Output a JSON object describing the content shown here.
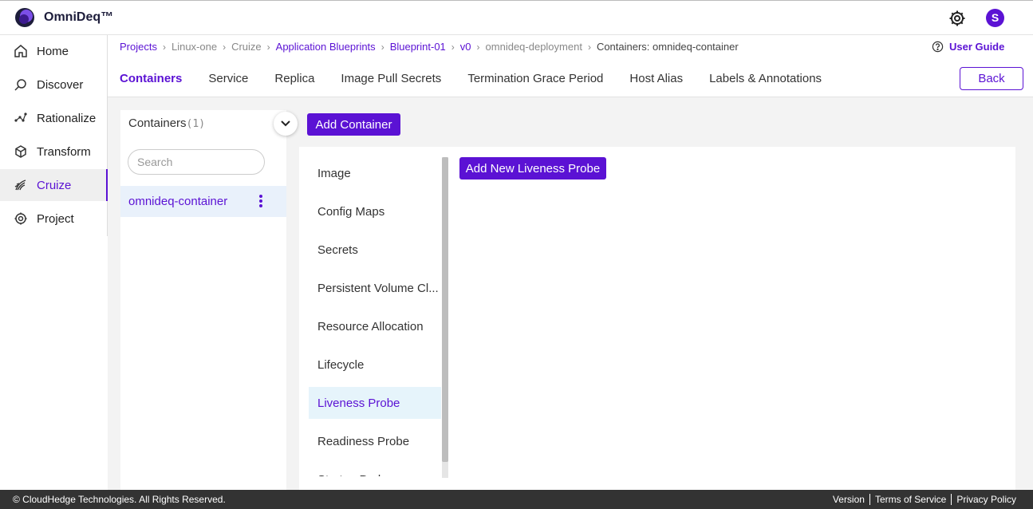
{
  "app": {
    "title": "OmniDeq™",
    "user_initial": "S"
  },
  "sidebar": {
    "items": [
      {
        "label": "Home",
        "icon": "home-icon"
      },
      {
        "label": "Discover",
        "icon": "discover-icon"
      },
      {
        "label": "Rationalize",
        "icon": "rationalize-icon"
      },
      {
        "label": "Transform",
        "icon": "transform-icon"
      },
      {
        "label": "Cruize",
        "icon": "cruize-icon",
        "active": true
      },
      {
        "label": "Project",
        "icon": "project-icon"
      }
    ]
  },
  "breadcrumb": [
    {
      "label": "Projects",
      "link": true
    },
    {
      "label": "Linux-one",
      "link": false
    },
    {
      "label": "Cruize",
      "link": false
    },
    {
      "label": "Application Blueprints",
      "link": true
    },
    {
      "label": "Blueprint-01",
      "link": true
    },
    {
      "label": "v0",
      "link": true
    },
    {
      "label": "omnideq-deployment",
      "link": false
    },
    {
      "label": "Containers: omnideq-container",
      "link": false,
      "current": true
    }
  ],
  "user_guide": "User Guide",
  "tabs": [
    {
      "label": "Containers",
      "active": true
    },
    {
      "label": "Service"
    },
    {
      "label": "Replica"
    },
    {
      "label": "Image Pull Secrets"
    },
    {
      "label": "Termination Grace Period"
    },
    {
      "label": "Host Alias"
    },
    {
      "label": "Labels & Annotations"
    }
  ],
  "back_label": "Back",
  "containers": {
    "title": "Containers",
    "count": "(1)",
    "search_placeholder": "Search",
    "items": [
      "omnideq-container"
    ],
    "add_label": "Add Container"
  },
  "sections": [
    "Image",
    "Config Maps",
    "Secrets",
    "Persistent Volume Cl...",
    "Resource Allocation",
    "Lifecycle",
    "Liveness Probe",
    "Readiness Probe",
    "Startup Probe"
  ],
  "active_section": "Liveness Probe",
  "add_probe_label": "Add New Liveness Probe",
  "footer": {
    "copyright": "© CloudHedge Technologies. All Rights Reserved.",
    "links": [
      "Version",
      "Terms of Service",
      "Privacy Policy"
    ]
  },
  "colors": {
    "accent": "#5b12d4",
    "footer_bg": "#333333",
    "active_row": "#e6f4fb"
  }
}
